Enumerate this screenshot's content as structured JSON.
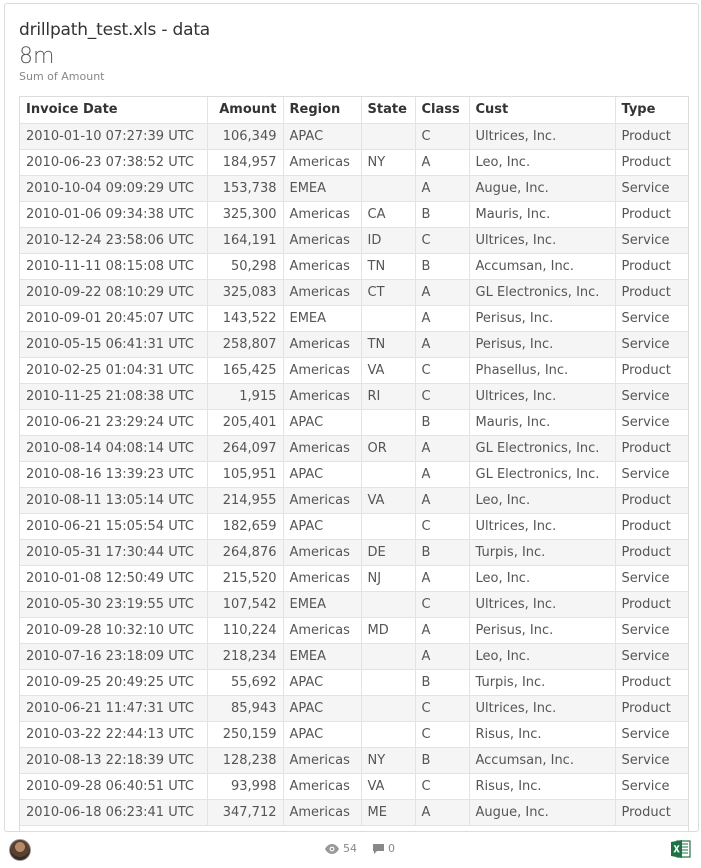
{
  "card": {
    "title": "drillpath_test.xls - data",
    "value": "8m",
    "value_label": "Sum of Amount"
  },
  "table": {
    "columns": [
      "Invoice Date",
      "Amount",
      "Region",
      "State",
      "Class",
      "Cust",
      "Type"
    ],
    "rows": [
      [
        "2010-01-10 07:27:39 UTC",
        "106,349",
        "APAC",
        "",
        "C",
        "Ultrices, Inc.",
        "Product"
      ],
      [
        "2010-06-23 07:38:52 UTC",
        "184,957",
        "Americas",
        "NY",
        "A",
        "Leo, Inc.",
        "Product"
      ],
      [
        "2010-10-04 09:09:29 UTC",
        "153,738",
        "EMEA",
        "",
        "A",
        "Augue, Inc.",
        "Service"
      ],
      [
        "2010-01-06 09:34:38 UTC",
        "325,300",
        "Americas",
        "CA",
        "B",
        "Mauris, Inc.",
        "Product"
      ],
      [
        "2010-12-24 23:58:06 UTC",
        "164,191",
        "Americas",
        "ID",
        "C",
        "Ultrices, Inc.",
        "Service"
      ],
      [
        "2010-11-11 08:15:08 UTC",
        "50,298",
        "Americas",
        "TN",
        "B",
        "Accumsan, Inc.",
        "Product"
      ],
      [
        "2010-09-22 08:10:29 UTC",
        "325,083",
        "Americas",
        "CT",
        "A",
        "GL Electronics, Inc.",
        "Product"
      ],
      [
        "2010-09-01 20:45:07 UTC",
        "143,522",
        "EMEA",
        "",
        "A",
        "Perisus, Inc.",
        "Service"
      ],
      [
        "2010-05-15 06:41:31 UTC",
        "258,807",
        "Americas",
        "TN",
        "A",
        "Perisus, Inc.",
        "Service"
      ],
      [
        "2010-02-25 01:04:31 UTC",
        "165,425",
        "Americas",
        "VA",
        "C",
        "Phasellus, Inc.",
        "Product"
      ],
      [
        "2010-11-25 21:08:38 UTC",
        "1,915",
        "Americas",
        "RI",
        "C",
        "Ultrices, Inc.",
        "Service"
      ],
      [
        "2010-06-21 23:29:24 UTC",
        "205,401",
        "APAC",
        "",
        "B",
        "Mauris, Inc.",
        "Service"
      ],
      [
        "2010-08-14 04:08:14 UTC",
        "264,097",
        "Americas",
        "OR",
        "A",
        "GL Electronics, Inc.",
        "Product"
      ],
      [
        "2010-08-16 13:39:23 UTC",
        "105,951",
        "APAC",
        "",
        "A",
        "GL Electronics, Inc.",
        "Service"
      ],
      [
        "2010-08-11 13:05:14 UTC",
        "214,955",
        "Americas",
        "VA",
        "A",
        "Leo, Inc.",
        "Product"
      ],
      [
        "2010-06-21 15:05:54 UTC",
        "182,659",
        "APAC",
        "",
        "C",
        "Ultrices, Inc.",
        "Product"
      ],
      [
        "2010-05-31 17:30:44 UTC",
        "264,876",
        "Americas",
        "DE",
        "B",
        "Turpis, Inc.",
        "Product"
      ],
      [
        "2010-01-08 12:50:49 UTC",
        "215,520",
        "Americas",
        "NJ",
        "A",
        "Leo, Inc.",
        "Service"
      ],
      [
        "2010-05-30 23:19:55 UTC",
        "107,542",
        "EMEA",
        "",
        "C",
        "Ultrices, Inc.",
        "Product"
      ],
      [
        "2010-09-28 10:32:10 UTC",
        "110,224",
        "Americas",
        "MD",
        "A",
        "Perisus, Inc.",
        "Service"
      ],
      [
        "2010-07-16 23:18:09 UTC",
        "218,234",
        "EMEA",
        "",
        "A",
        "Leo, Inc.",
        "Service"
      ],
      [
        "2010-09-25 20:49:25 UTC",
        "55,692",
        "APAC",
        "",
        "B",
        "Turpis, Inc.",
        "Product"
      ],
      [
        "2010-06-21 11:47:31 UTC",
        "85,943",
        "APAC",
        "",
        "C",
        "Ultrices, Inc.",
        "Product"
      ],
      [
        "2010-03-22 22:44:13 UTC",
        "250,159",
        "APAC",
        "",
        "C",
        "Risus, Inc.",
        "Service"
      ],
      [
        "2010-08-13 22:18:39 UTC",
        "128,238",
        "Americas",
        "NY",
        "B",
        "Accumsan, Inc.",
        "Service"
      ],
      [
        "2010-09-28 06:40:51 UTC",
        "93,998",
        "Americas",
        "VA",
        "C",
        "Risus, Inc.",
        "Service"
      ],
      [
        "2010-06-18 06:23:41 UTC",
        "347,712",
        "Americas",
        "ME",
        "A",
        "Augue, Inc.",
        "Product"
      ]
    ]
  },
  "footer": {
    "views": "54",
    "comments": "0",
    "view_icon": "eye-icon",
    "comment_icon": "comment-icon",
    "export_icon": "excel-icon",
    "excel_color": "#1e7145"
  }
}
